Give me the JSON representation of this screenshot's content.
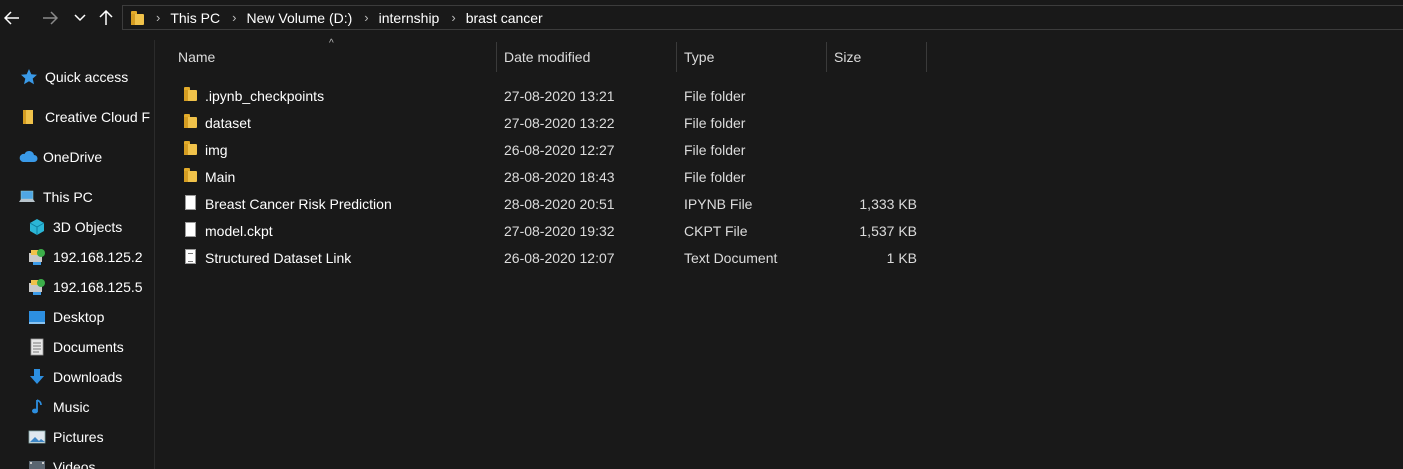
{
  "breadcrumb": [
    "This PC",
    "New Volume (D:)",
    "internship",
    "brast cancer"
  ],
  "columns": {
    "name": "Name",
    "date": "Date modified",
    "type": "Type",
    "size": "Size"
  },
  "sidebar": [
    {
      "label": "Quick access",
      "icon": "star-icon"
    },
    {
      "label": "Creative Cloud F",
      "icon": "folder-icon"
    },
    {
      "label": "OneDrive",
      "icon": "cloud-icon"
    },
    {
      "label": "This PC",
      "icon": "computer-icon"
    },
    {
      "label": "3D Objects",
      "icon": "cube-icon"
    },
    {
      "label": "192.168.125.2",
      "icon": "network-drive-icon"
    },
    {
      "label": "192.168.125.5",
      "icon": "network-drive-icon"
    },
    {
      "label": "Desktop",
      "icon": "desktop-icon"
    },
    {
      "label": "Documents",
      "icon": "documents-icon"
    },
    {
      "label": "Downloads",
      "icon": "download-icon"
    },
    {
      "label": "Music",
      "icon": "music-icon"
    },
    {
      "label": "Pictures",
      "icon": "pictures-icon"
    },
    {
      "label": "Videos",
      "icon": "videos-icon"
    }
  ],
  "files": [
    {
      "name": ".ipynb_checkpoints",
      "date": "27-08-2020 13:21",
      "type": "File folder",
      "size": "",
      "icon": "folder-icon"
    },
    {
      "name": "dataset",
      "date": "27-08-2020 13:22",
      "type": "File folder",
      "size": "",
      "icon": "folder-icon"
    },
    {
      "name": "img",
      "date": "26-08-2020 12:27",
      "type": "File folder",
      "size": "",
      "icon": "folder-icon"
    },
    {
      "name": "Main",
      "date": "28-08-2020 18:43",
      "type": "File folder",
      "size": "",
      "icon": "folder-icon"
    },
    {
      "name": "Breast Cancer Risk Prediction",
      "date": "28-08-2020 20:51",
      "type": "IPYNB File",
      "size": "1,333 KB",
      "icon": "file-icon"
    },
    {
      "name": "model.ckpt",
      "date": "27-08-2020 19:32",
      "type": "CKPT File",
      "size": "1,537 KB",
      "icon": "file-icon"
    },
    {
      "name": "Structured Dataset Link",
      "date": "26-08-2020 12:07",
      "type": "Text Document",
      "size": "1 KB",
      "icon": "text-file-icon"
    }
  ]
}
